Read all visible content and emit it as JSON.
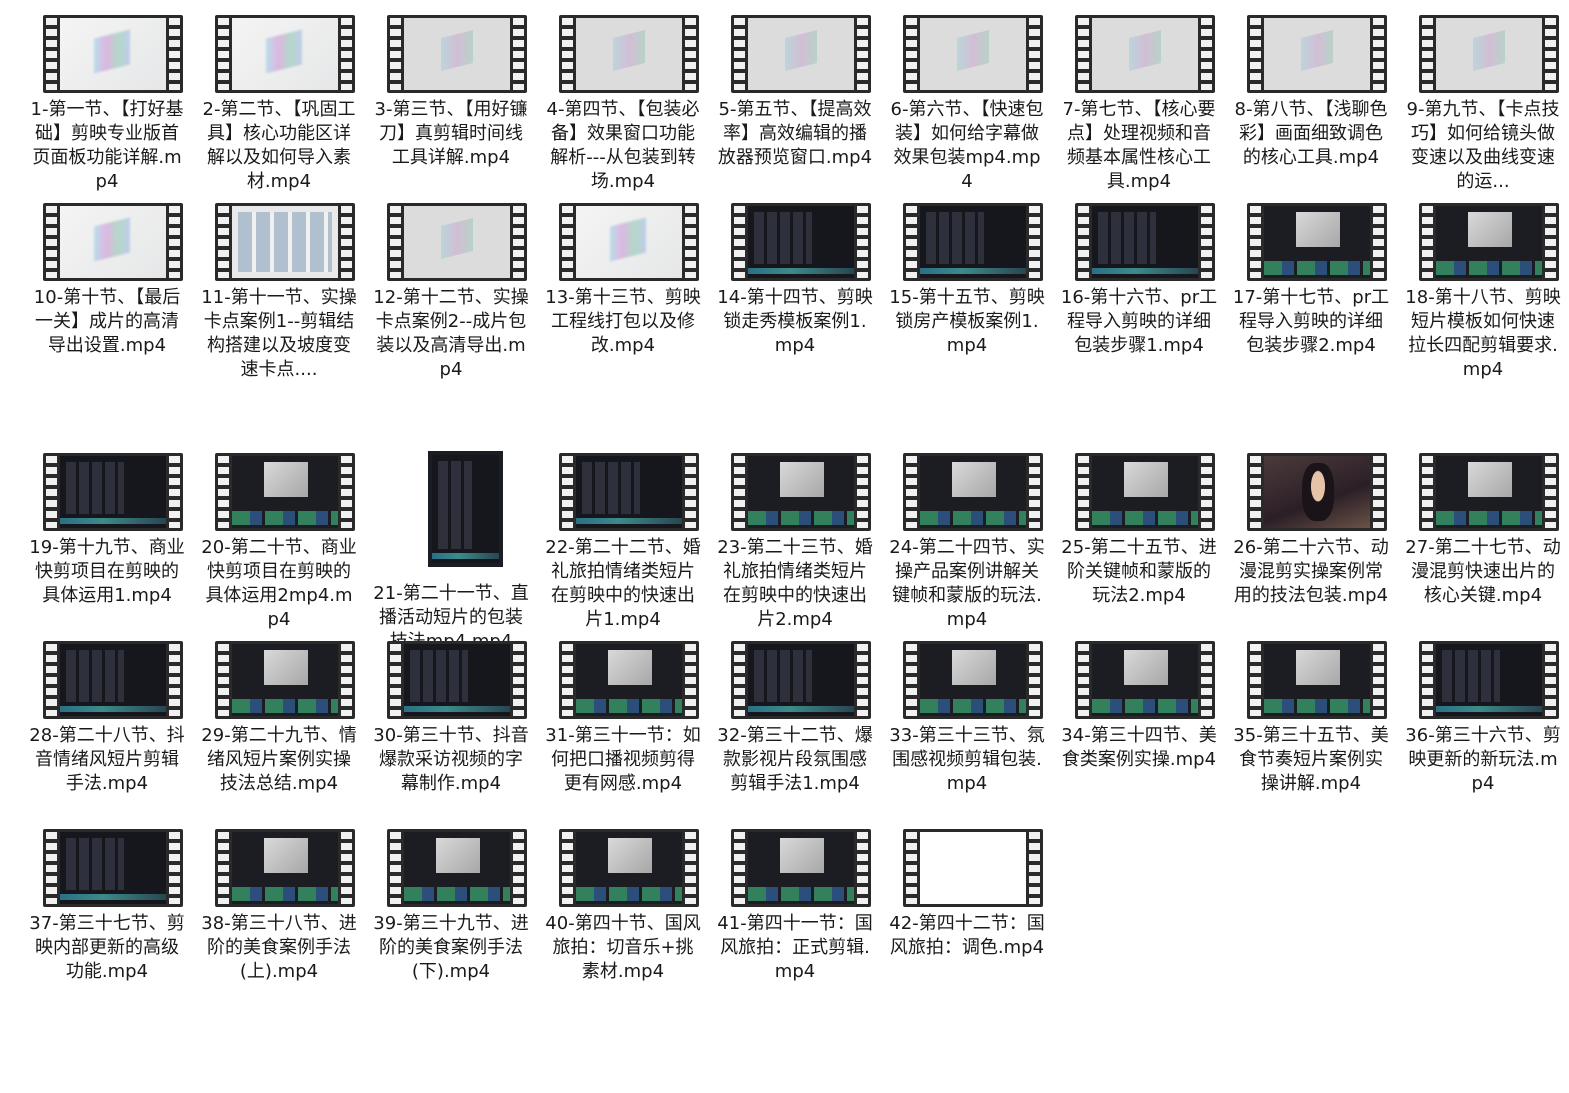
{
  "files": [
    {
      "name": "1-第一节、【打好基础】剪映专业版首页面板功能详解.mp4",
      "thumbnail": "light"
    },
    {
      "name": "2-第二节、【巩固工具】核心功能区详解以及如何导入素材.mp4",
      "thumbnail": "light"
    },
    {
      "name": "3-第三节、【用好镰刀】真剪辑时间线工具详解.mp4",
      "thumbnail": "lightgray"
    },
    {
      "name": "4-第四节、【包装必备】效果窗口功能解析---从包装到转场.mp4",
      "thumbnail": "lightgray"
    },
    {
      "name": "5-第五节、【提高效率】高效编辑的播放器预览窗口.mp4",
      "thumbnail": "lightgray"
    },
    {
      "name": "6-第六节、【快速包装】如何给字幕做效果包装mp4.mp4",
      "thumbnail": "lightgray"
    },
    {
      "name": "7-第七节、【核心要点】处理视频和音频基本属性核心工具.mp4",
      "thumbnail": "lightgray"
    },
    {
      "name": "8-第八节、【浅聊色彩】画面细致调色的核心工具.mp4",
      "thumbnail": "lightgray"
    },
    {
      "name": "9-第九节、【卡点技巧】如何给镜头做变速以及曲线变速的运...",
      "thumbnail": "lightgray"
    },
    {
      "name": "10-第十节、【最后一关】成片的高清导出设置.mp4",
      "thumbnail": "light"
    },
    {
      "name": "11-第十一节、实操卡点案例1--剪辑结构搭建以及坡度变速卡点....",
      "thumbnail": "desk"
    },
    {
      "name": "12-第十二节、实操卡点案例2--成片包装以及高清导出.mp4",
      "thumbnail": "lightgray"
    },
    {
      "name": "13-第十三节、剪映工程线打包以及修改.mp4",
      "thumbnail": "light"
    },
    {
      "name": "14-第十四节、剪映锁走秀模板案例1.mp4",
      "thumbnail": "dark"
    },
    {
      "name": "15-第十五节、剪映锁房产模板案例1.mp4",
      "thumbnail": "dark"
    },
    {
      "name": "16-第十六节、pr工程导入剪映的详细包装步骤1.mp4",
      "thumbnail": "dark"
    },
    {
      "name": "17-第十七节、pr工程导入剪映的详细包装步骤2.mp4",
      "thumbnail": "editor"
    },
    {
      "name": "18-第十八节、剪映短片模板如何快速拉长四配剪辑要求.mp4",
      "thumbnail": "editor"
    },
    {
      "name": "19-第十九节、商业快剪项目在剪映的具体运用1.mp4",
      "thumbnail": "dark"
    },
    {
      "name": "20-第二十节、商业快剪项目在剪映的具体运用2mp4.mp4",
      "thumbnail": "editor"
    },
    {
      "name": "21-第二十一节、直播活动短片的包装技法mp4.mp4",
      "thumbnail": "portrait"
    },
    {
      "name": "22-第二十二节、婚礼旅拍情绪类短片在剪映中的快速出片1.mp4",
      "thumbnail": "dark"
    },
    {
      "name": "23-第二十三节、婚礼旅拍情绪类短片在剪映中的快速出片2.mp4",
      "thumbnail": "editor"
    },
    {
      "name": "24-第二十四节、实操产品案例讲解关键帧和蒙版的玩法.mp4",
      "thumbnail": "editor"
    },
    {
      "name": "25-第二十五节、进阶关键帧和蒙版的玩法2.mp4",
      "thumbnail": "editor"
    },
    {
      "name": "26-第二十六节、动漫混剪实操案例常用的技法包装.mp4",
      "thumbnail": "anime"
    },
    {
      "name": "27-第二十七节、动漫混剪快速出片的核心关键.mp4",
      "thumbnail": "editor"
    },
    {
      "name": "28-第二十八节、抖音情绪风短片剪辑手法.mp4",
      "thumbnail": "dark"
    },
    {
      "name": "29-第二十九节、情绪风短片案例实操技法总结.mp4",
      "thumbnail": "editor"
    },
    {
      "name": "30-第三十节、抖音爆款采访视频的字幕制作.mp4",
      "thumbnail": "dark"
    },
    {
      "name": "31-第三十一节：如何把口播视频剪得更有网感.mp4",
      "thumbnail": "editor"
    },
    {
      "name": "32-第三十二节、爆款影视片段氛围感剪辑手法1.mp4",
      "thumbnail": "dark"
    },
    {
      "name": "33-第三十三节、氛围感视频剪辑包装.mp4",
      "thumbnail": "editor"
    },
    {
      "name": "34-第三十四节、美食类案例实操.mp4",
      "thumbnail": "editor"
    },
    {
      "name": "35-第三十五节、美食节奏短片案例实操讲解.mp4",
      "thumbnail": "editor"
    },
    {
      "name": "36-第三十六节、剪映更新的新玩法.mp4",
      "thumbnail": "dark"
    },
    {
      "name": "37-第三十七节、剪映内部更新的高级功能.mp4",
      "thumbnail": "dark"
    },
    {
      "name": "38-第三十八节、进阶的美食案例手法(上).mp4",
      "thumbnail": "editor"
    },
    {
      "name": "39-第三十九节、进阶的美食案例手法(下).mp4",
      "thumbnail": "editor"
    },
    {
      "name": "40-第四十节、国风旅拍：切音乐+挑素材.mp4",
      "thumbnail": "editor"
    },
    {
      "name": "41-第四十一节：国风旅拍：正式剪辑.mp4",
      "thumbnail": "editor"
    },
    {
      "name": "42-第四十二节：国风旅拍：调色.mp4",
      "thumbnail": "white"
    }
  ]
}
